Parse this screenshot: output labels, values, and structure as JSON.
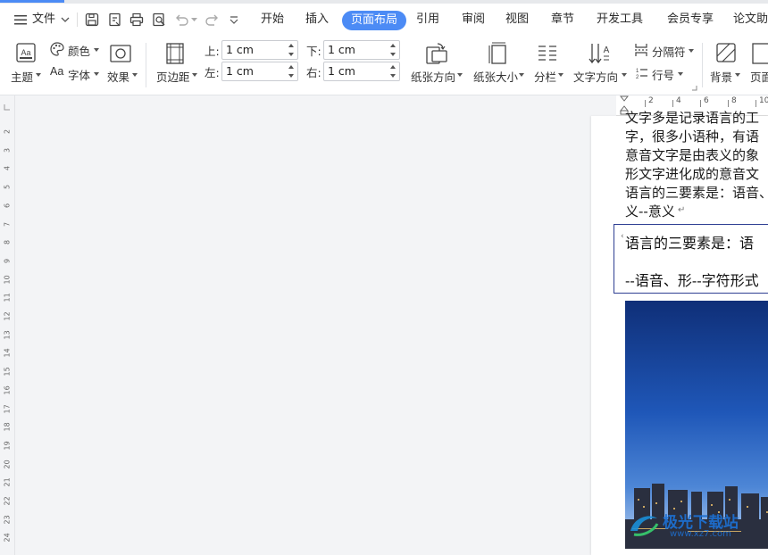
{
  "menu": {
    "file_label": "文件",
    "tabs": [
      {
        "label": "开始"
      },
      {
        "label": "插入"
      },
      {
        "label": "页面布局",
        "active": true
      },
      {
        "label": "引用"
      },
      {
        "label": "审阅"
      },
      {
        "label": "视图"
      },
      {
        "label": "章节"
      },
      {
        "label": "开发工具"
      },
      {
        "label": "会员专享"
      },
      {
        "label": "论文助手"
      }
    ]
  },
  "ribbon": {
    "theme_label": "主题",
    "colors_label": "颜色",
    "fonts_label": "字体",
    "effects_label": "效果",
    "margins_label": "页边距",
    "margin_top_label": "上:",
    "margin_top_value": "1 cm",
    "margin_left_label": "左:",
    "margin_left_value": "1 cm",
    "margin_bottom_label": "下:",
    "margin_bottom_value": "1 cm",
    "margin_right_label": "右:",
    "margin_right_value": "1 cm",
    "orientation_label": "纸张方向",
    "size_label": "纸张大小",
    "columns_label": "分栏",
    "text_direction_label": "文字方向",
    "breaks_label": "分隔符",
    "line_numbers_label": "行号",
    "background_label": "背景",
    "page_border_label": "页面"
  },
  "ruler": {
    "top_marks": [
      "2",
      "4",
      "6",
      "8",
      "10"
    ],
    "left_marks": [
      "2",
      "3",
      "4",
      "5",
      "6",
      "7",
      "8",
      "9",
      "10",
      "11",
      "12",
      "13",
      "14",
      "15",
      "16",
      "17",
      "18",
      "19",
      "20",
      "21",
      "22",
      "23",
      "24"
    ]
  },
  "document": {
    "lines": [
      "文字多是记录语言的工",
      "字，很多小语种，有语",
      "意音文字是由表义的象",
      "形文字进化成的意音文",
      "语言的三要素是：语音、",
      "义--意义"
    ],
    "textbox_lines": [
      "语言的三要素是：语",
      "--语音、形--字符形式"
    ],
    "watermark_text": "极光下载站",
    "watermark_url": "www.xz7.com"
  },
  "colors": {
    "accent": "#4c8bf5",
    "textbox_border": "#2f3f93"
  }
}
